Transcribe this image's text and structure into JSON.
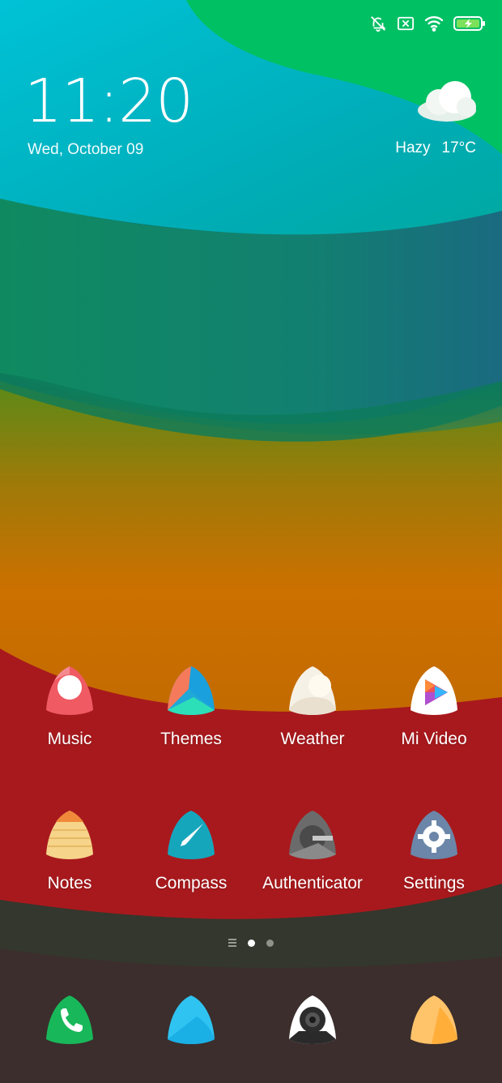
{
  "status": {
    "icons": [
      "silent-alarm-icon",
      "no-sim-icon",
      "wifi-icon",
      "battery-charging-icon"
    ]
  },
  "lockscreen": {
    "time": "11:20",
    "date": "Wed, October 09",
    "weather_condition": "Hazy",
    "weather_temp": "17°C",
    "weather_icon": "cloud-icon"
  },
  "apps": [
    {
      "label": "Music",
      "icon": "music-icon"
    },
    {
      "label": "Themes",
      "icon": "themes-icon"
    },
    {
      "label": "Weather",
      "icon": "weather-app-icon"
    },
    {
      "label": "Mi Video",
      "icon": "mi-video-icon"
    },
    {
      "label": "Notes",
      "icon": "notes-icon"
    },
    {
      "label": "Compass",
      "icon": "compass-icon"
    },
    {
      "label": "Authenticator",
      "icon": "authenticator-icon"
    },
    {
      "label": "Settings",
      "icon": "settings-gear-icon"
    }
  ],
  "page_indicator": {
    "pages": 2,
    "current": 1
  },
  "dock": [
    {
      "icon": "phone-icon"
    },
    {
      "icon": "messaging-icon"
    },
    {
      "icon": "camera-icon"
    },
    {
      "icon": "browser-icon"
    }
  ],
  "colors": {
    "top_cyan": "#00b8c8",
    "green": "#00c060",
    "orange": "#c97000",
    "red": "#a8181c",
    "dark": "#3a2c2c"
  }
}
